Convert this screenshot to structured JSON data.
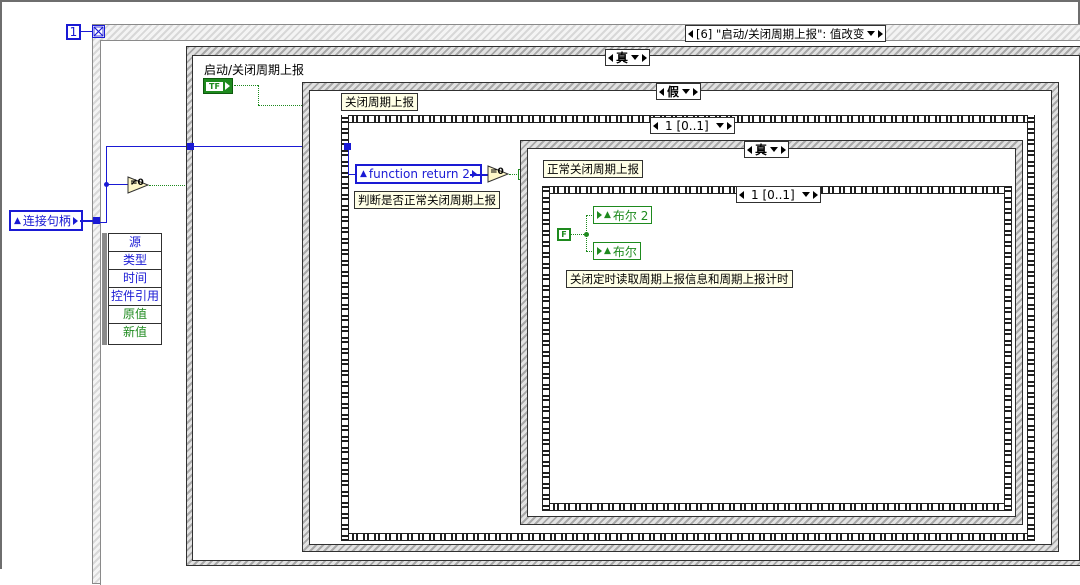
{
  "event_structure": {
    "frame_index": "1",
    "selector_label": "[6] \"启动/关闭周期上报\": 值改变"
  },
  "left_controls": {
    "connection_handle": "连接句柄",
    "not_equal_zero": "≠0",
    "event_data_fields": [
      "源",
      "类型",
      "时间",
      "控件引用",
      "原值",
      "新值"
    ]
  },
  "outer_case": {
    "selector_label": "真",
    "control_label": "启动/关闭周期上报",
    "bool_constant": "TF"
  },
  "false_case": {
    "selector_label": "假",
    "label": "关闭周期上报",
    "sequence_selector": "1 [0..1]",
    "function_return": "function return 2",
    "compare_label": "=0",
    "judge_label": "判断是否正常关闭周期上报"
  },
  "inner_true_case": {
    "selector_label": "真",
    "label": "正常关闭周期上报",
    "sequence_selector": "1 [0..1]",
    "false_constant": "F",
    "bool2_local": "布尔 2",
    "bool_local": "布尔",
    "comment": "关闭定时读取周期上报信息和周期上报计时"
  },
  "colors": {
    "wire_blue": "#1a1ad4",
    "wire_green": "#1e8a1e",
    "label_bg": "#ffffe6"
  }
}
